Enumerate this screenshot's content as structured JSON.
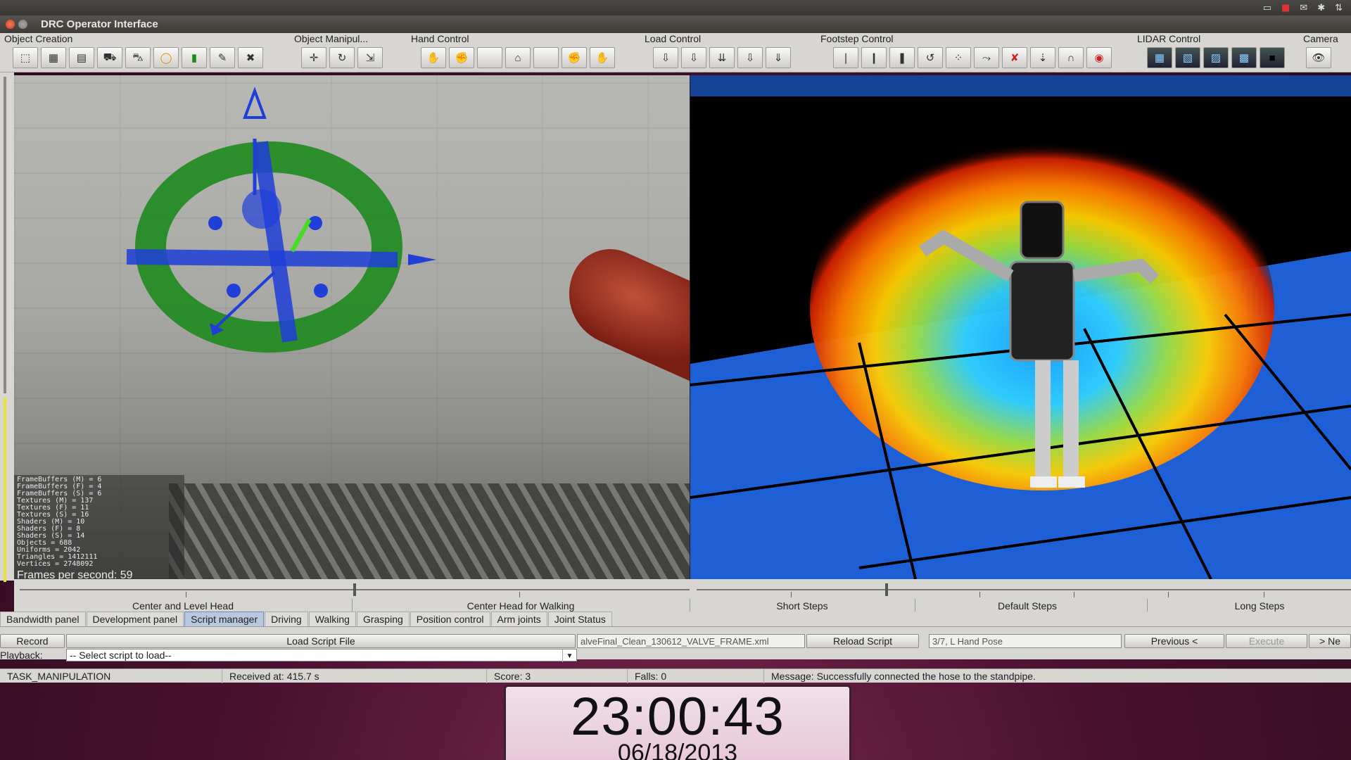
{
  "system": {
    "window_title": "DRC Operator Interface"
  },
  "toolbar": {
    "groups": [
      {
        "label": "Object Creation"
      },
      {
        "label": "Object Manipul..."
      },
      {
        "label": "Hand Control"
      },
      {
        "label": "Load Control"
      },
      {
        "label": "Footstep Control"
      },
      {
        "label": "LIDAR Control"
      },
      {
        "label": "Camera"
      }
    ]
  },
  "stats": {
    "lines": [
      "FrameBuffers (M) = 6",
      "FrameBuffers (F) = 4",
      "FrameBuffers (S) = 6",
      "Textures (M) = 137",
      "Textures (F) = 11",
      "Textures (S) = 16",
      "Shaders (M) = 10",
      "Shaders (F) = 8",
      "Shaders (S) = 14",
      "Objects = 688",
      "Uniforms = 2042",
      "Triangles = 1412111",
      "Vertices = 2748092"
    ],
    "fps": "Frames per second: 59"
  },
  "sliders": {
    "left_label": "Center and Level Head",
    "mid_label": "Center Head for Walking",
    "short": "Short Steps",
    "default": "Default Steps",
    "long": "Long Steps"
  },
  "tabs": [
    {
      "label": "Bandwidth panel"
    },
    {
      "label": "Development panel"
    },
    {
      "label": "Script manager",
      "active": true
    },
    {
      "label": "Driving"
    },
    {
      "label": "Walking"
    },
    {
      "label": "Grasping"
    },
    {
      "label": "Position control"
    },
    {
      "label": "Arm joints"
    },
    {
      "label": "Joint Status"
    }
  ],
  "script": {
    "record": "Record",
    "load_script_file": "Load Script File",
    "file_name": "alveFinal_Clean_130612_VALVE_FRAME.xml",
    "reload": "Reload Script",
    "step": "3/7, L Hand Pose",
    "previous": "Previous <",
    "execute": "Execute",
    "next": "> Ne",
    "playback_label": "Playback:",
    "playback_select": "-- Select script to load--"
  },
  "status": {
    "task": "TASK_MANIPULATION",
    "received": "Received at:  415.7 s",
    "score": "Score:  3",
    "falls": "Falls:  0",
    "message": "Message:  Successfully connected the hose to the standpipe."
  },
  "clock": {
    "time": "23:00:43",
    "date": "06/18/2013"
  },
  "colors": {
    "accent_blue": "#1f3fd8",
    "torus_green": "#1e8a1e",
    "floor_blue": "#1e5fd6",
    "tab_active": "#b8c8e0"
  }
}
